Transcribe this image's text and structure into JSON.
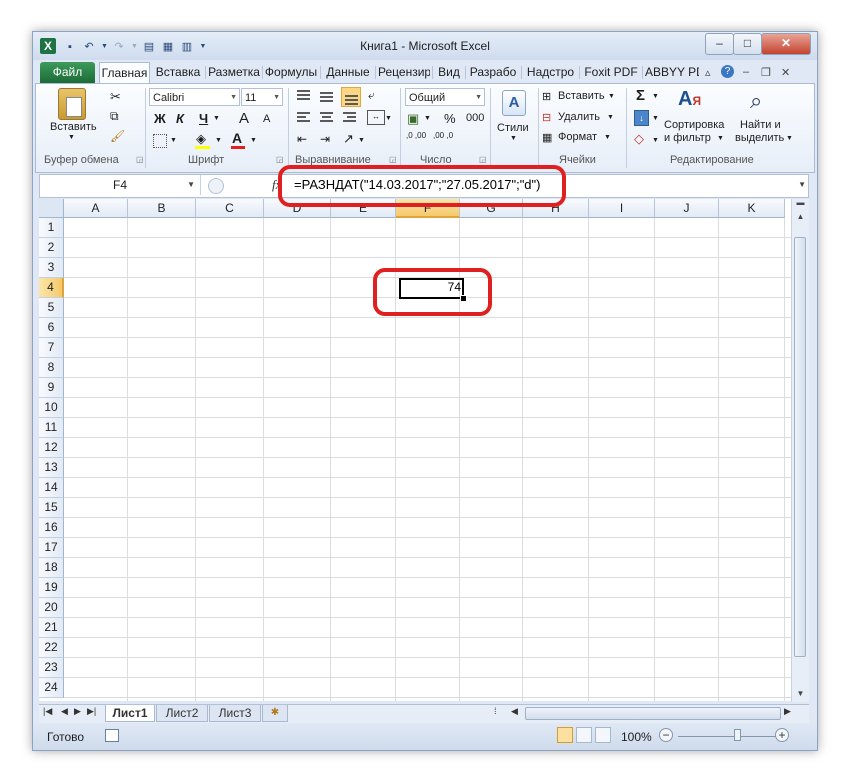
{
  "window": {
    "title": "Книга1  -  Microsoft Excel",
    "app_logo": "X",
    "controls": {
      "minimize": "–",
      "maximize": "□",
      "close": "✕"
    }
  },
  "qat": {
    "icons": [
      "save-icon",
      "undo-icon",
      "redo-icon",
      "form-icon",
      "table-icon",
      "calc-icon",
      "customize-icon"
    ]
  },
  "tabs": [
    {
      "label": "Файл"
    },
    {
      "label": "Главная"
    },
    {
      "label": "Вставка"
    },
    {
      "label": "Разметка"
    },
    {
      "label": "Формулы"
    },
    {
      "label": "Данные"
    },
    {
      "label": "Рецензир"
    },
    {
      "label": "Вид"
    },
    {
      "label": "Разрабо"
    },
    {
      "label": "Надстро"
    },
    {
      "label": "Foxit PDF"
    },
    {
      "label": "ABBYY PD"
    }
  ],
  "ribbon": {
    "clipboard": {
      "label": "Буфер обмена",
      "paste": "Вставить"
    },
    "font": {
      "label": "Шрифт",
      "name": "Calibri",
      "size": "11",
      "bold": "Ж",
      "italic": "К",
      "underline": "Ч",
      "grow": "A",
      "shrink": "A"
    },
    "alignment": {
      "label": "Выравнивание"
    },
    "number": {
      "label": "Число",
      "format": "Общий",
      "percent": "%",
      "thousands": "000",
      "inc_decimal": ",0 ,00",
      "dec_decimal": ",00 ,0"
    },
    "styles": {
      "label": "Стили"
    },
    "cells": {
      "label": "Ячейки",
      "insert": "Вставить",
      "delete": "Удалить",
      "format": "Формат"
    },
    "editing": {
      "label": "Редактирование",
      "sum": "Σ",
      "sort_line1": "Сортировка",
      "sort_line2": "и фильтр",
      "find_line1": "Найти и",
      "find_line2": "выделить"
    }
  },
  "formula_bar": {
    "name_box": "F4",
    "fx": "fx",
    "formula": "=РАЗНДАТ(\"14.03.2017\";\"27.05.2017\";\"d\")"
  },
  "grid": {
    "columns": [
      "A",
      "B",
      "C",
      "D",
      "E",
      "F",
      "G",
      "H",
      "I",
      "J",
      "K"
    ],
    "rows": [
      "1",
      "2",
      "3",
      "4",
      "5",
      "6",
      "7",
      "8",
      "9",
      "10",
      "11",
      "12",
      "13",
      "14",
      "15",
      "16",
      "17",
      "18",
      "19",
      "20",
      "21",
      "22",
      "23",
      "24"
    ],
    "selected_column": "F",
    "selected_row": "4",
    "active_cell_value": "74"
  },
  "sheets": [
    {
      "label": "Лист1"
    },
    {
      "label": "Лист2"
    },
    {
      "label": "Лист3"
    }
  ],
  "status": {
    "ready": "Готово",
    "zoom": "100%",
    "zoom_fraction": 0.55
  },
  "colors": {
    "highlight": "#e02020",
    "file_tab": "#1c6b36",
    "excel_logo": "#1f7244"
  }
}
